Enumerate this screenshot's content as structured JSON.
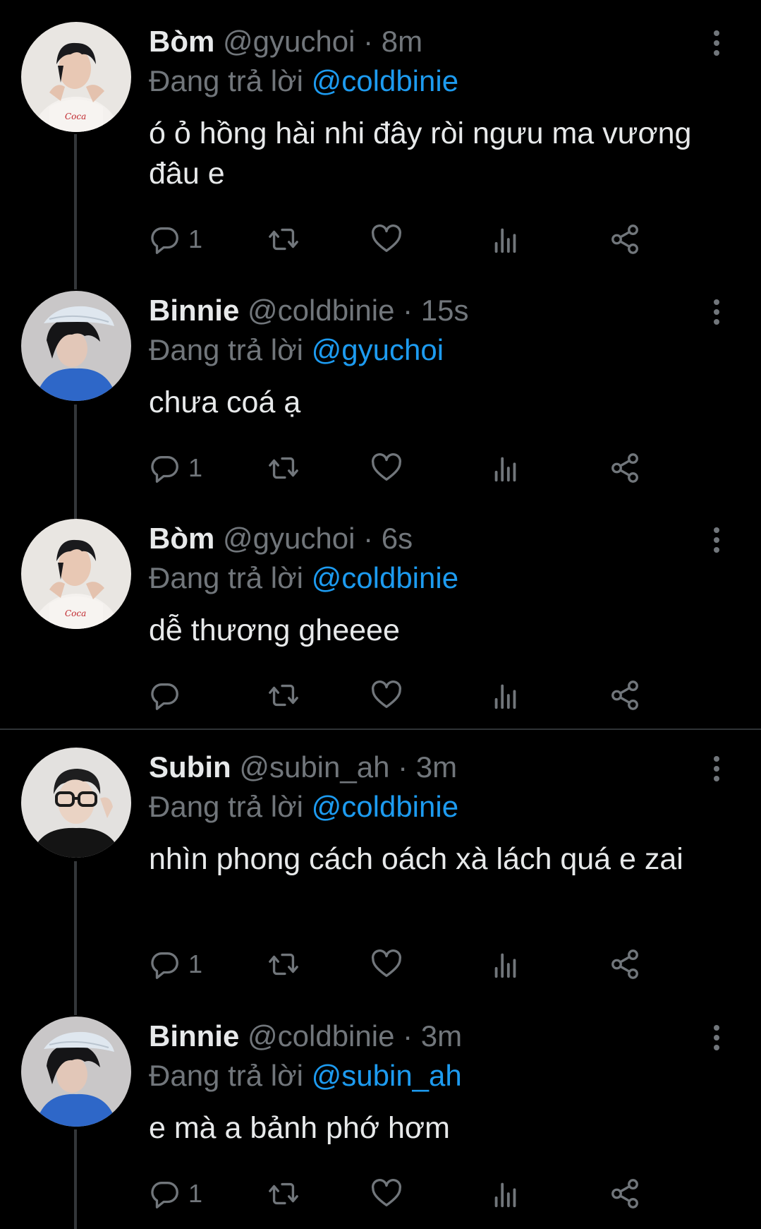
{
  "colors": {
    "background": "#000000",
    "text": "#e7e9ea",
    "muted": "#71767b",
    "accent": "#1d9bf0",
    "thread_line": "#333639"
  },
  "icons": {
    "reply": "reply-icon",
    "retweet": "retweet-icon",
    "like": "heart-icon",
    "views": "views-icon",
    "share": "share-icon",
    "more": "more-icon"
  },
  "reply_prefix": "Đang trả lời",
  "tweets": [
    {
      "name": "Bòm",
      "handle": "@gyuchoi",
      "time": "· 8m",
      "reply_to": "@coldbinie",
      "text": "ó ỏ hồng hài nhi đây ròi ngưu ma vương đâu e",
      "reply_count": "1"
    },
    {
      "name": "Binnie",
      "handle": "@coldbinie",
      "time": "· 15s",
      "reply_to": "@gyuchoi",
      "text": "chưa coá ạ",
      "reply_count": "1"
    },
    {
      "name": "Bòm",
      "handle": "@gyuchoi",
      "time": "· 6s",
      "reply_to": "@coldbinie",
      "text": "dễ thương gheeee",
      "reply_count": ""
    },
    {
      "name": "Subin",
      "handle": "@subin_ah",
      "time": "· 3m",
      "reply_to": "@coldbinie",
      "text": "nhìn phong cách oách xà lách quá e zai",
      "reply_count": "1"
    },
    {
      "name": "Binnie",
      "handle": "@coldbinie",
      "time": "· 3m",
      "reply_to": "@subin_ah",
      "text": "e mà a bảnh phớ hơm",
      "reply_count": "1"
    }
  ]
}
